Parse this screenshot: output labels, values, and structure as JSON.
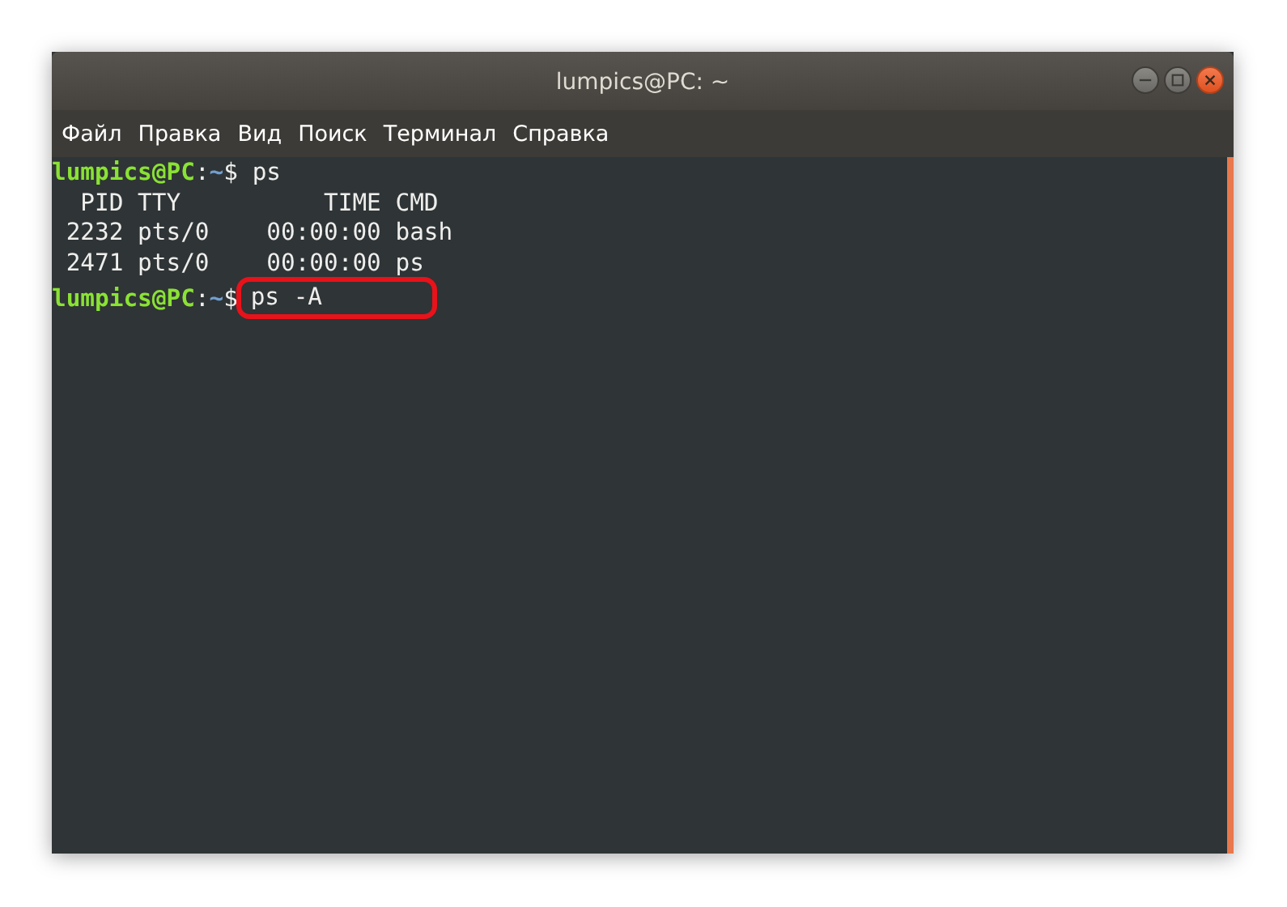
{
  "window": {
    "title": "lumpics@PC: ~"
  },
  "menu": [
    "Файл",
    "Правка",
    "Вид",
    "Поиск",
    "Терминал",
    "Справка"
  ],
  "terminal": {
    "lines": [
      {
        "kind": "prompt",
        "user": "lumpics@PC",
        "sep": ":",
        "path": "~",
        "symbol": "$",
        "command": "ps",
        "highlighted": false
      },
      {
        "kind": "output",
        "text": "  PID TTY          TIME CMD"
      },
      {
        "kind": "output",
        "text": " 2232 pts/0    00:00:00 bash"
      },
      {
        "kind": "output",
        "text": " 2471 pts/0    00:00:00 ps"
      },
      {
        "kind": "prompt",
        "user": "lumpics@PC",
        "sep": ":",
        "path": "~",
        "symbol": "$",
        "command": "ps -A",
        "highlighted": true
      }
    ]
  }
}
